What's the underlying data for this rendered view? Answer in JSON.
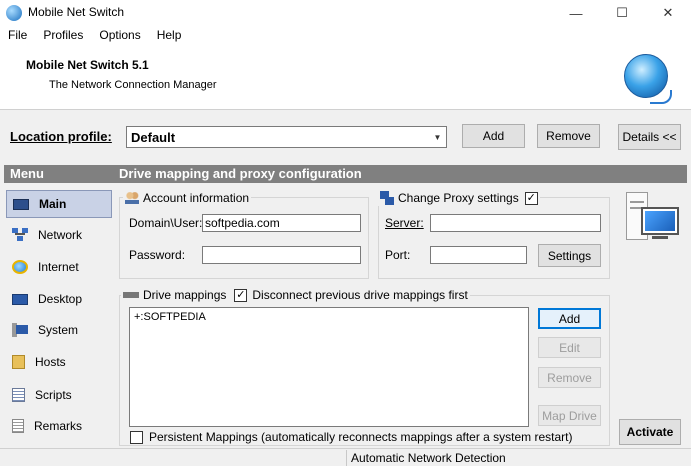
{
  "window": {
    "title": "Mobile Net Switch",
    "controls": {
      "minimize": "—",
      "maximize": "☐",
      "close": "✕"
    }
  },
  "menubar": [
    "File",
    "Profiles",
    "Options",
    "Help"
  ],
  "header": {
    "app_name": "Mobile Net Switch 5.1",
    "subtitle": "The Network Connection Manager",
    "logo_icon": "globe-network-icon"
  },
  "location": {
    "label": "Location profile:",
    "selected": "Default",
    "add_label": "Add",
    "remove_label": "Remove",
    "details_label": "Details <<"
  },
  "section": {
    "menu_label": "Menu",
    "title": "Drive mapping and proxy configuration"
  },
  "sidebar": {
    "items": [
      {
        "label": "Main",
        "icon": "main-monitor-icon",
        "selected": true
      },
      {
        "label": "Network",
        "icon": "network-icon",
        "selected": false
      },
      {
        "label": "Internet",
        "icon": "internet-explorer-icon",
        "selected": false
      },
      {
        "label": "Desktop",
        "icon": "desktop-icon",
        "selected": false
      },
      {
        "label": "System",
        "icon": "system-icon",
        "selected": false
      },
      {
        "label": "Hosts",
        "icon": "hosts-icon",
        "selected": false
      },
      {
        "label": "Scripts",
        "icon": "scripts-icon",
        "selected": false
      },
      {
        "label": "Remarks",
        "icon": "remarks-icon",
        "selected": false
      }
    ]
  },
  "account": {
    "title": "Account information",
    "domain_label": "Domain\\User:",
    "domain_value": "softpedia.com",
    "password_label": "Password:",
    "password_value": ""
  },
  "proxy": {
    "title": "Change Proxy settings",
    "enabled": true,
    "server_label": "Server:",
    "server_value": "",
    "port_label": "Port:",
    "port_value": "",
    "settings_label": "Settings"
  },
  "drives": {
    "title": "Drive mappings",
    "disconnect_label": "Disconnect previous drive mappings first",
    "disconnect_checked": true,
    "items": [
      "+:SOFTPEDIA"
    ],
    "add_label": "Add",
    "edit_label": "Edit",
    "remove_label": "Remove",
    "map_label": "Map Drive",
    "persistent_label": "Persistent Mappings (automatically reconnects mappings after a system restart)",
    "persistent_checked": false
  },
  "activate_label": "Activate",
  "status": {
    "left": "",
    "right": "Automatic Network Detection"
  },
  "colors": {
    "section_bar": "#808080",
    "selected_item": "#c9d2e6",
    "primary_border": "#0078d7"
  }
}
